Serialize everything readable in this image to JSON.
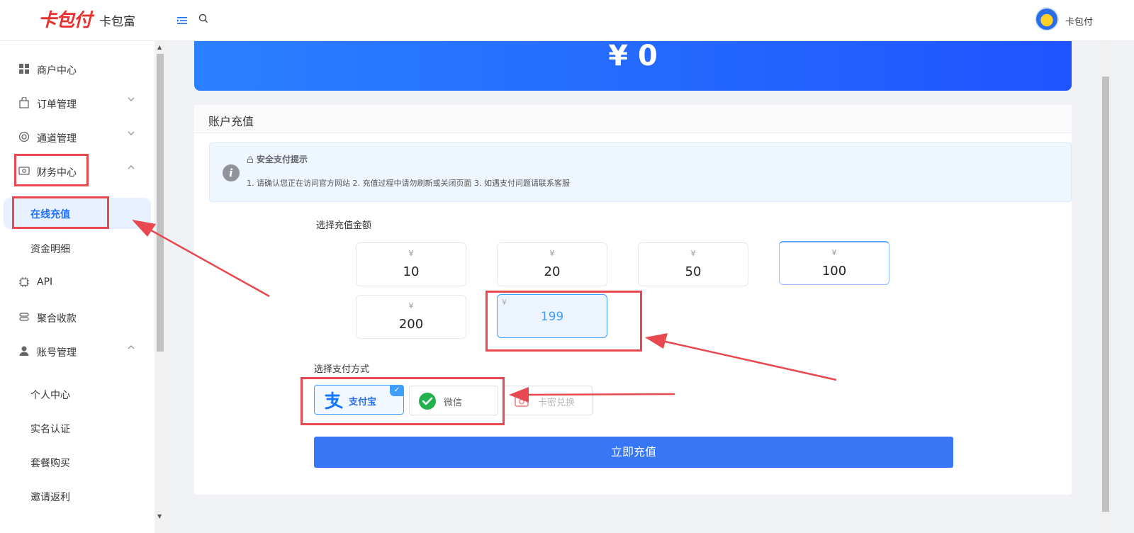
{
  "header": {
    "logo_text": "卡包付",
    "brand_name": "卡包富",
    "user_name": "卡包付",
    "menu_toggle_icon": "menu-fold-icon",
    "search_icon": "search-icon"
  },
  "sidebar": {
    "items": [
      {
        "label": "商户中心",
        "icon": "grid-icon"
      },
      {
        "label": "订单管理",
        "icon": "bag-icon"
      },
      {
        "label": "通道管理",
        "icon": "channel-icon"
      },
      {
        "label": "财务中心",
        "icon": "wallet-icon"
      },
      {
        "label": "API",
        "icon": "chip-icon"
      },
      {
        "label": "聚合收款",
        "icon": "aggregate-icon"
      },
      {
        "label": "账号管理",
        "icon": "user-icon"
      }
    ],
    "finance_sub": [
      {
        "label": "在线充值",
        "active": true
      },
      {
        "label": "资金明细"
      }
    ],
    "account_sub": [
      {
        "label": "个人中心"
      },
      {
        "label": "实名认证"
      },
      {
        "label": "套餐购买"
      },
      {
        "label": "邀请返利"
      }
    ]
  },
  "balance": {
    "display": "¥ 0"
  },
  "recharge": {
    "title": "账户充值",
    "notice_title": "安全支付提示",
    "notice_text": "1. 请确认您正在访问官方网站 2. 充值过程中请勿刷新或关闭页面 3. 如遇支付问题请联系客服",
    "amount_label": "选择充值金额",
    "currency": "¥",
    "amounts": [
      {
        "value": "10"
      },
      {
        "value": "20"
      },
      {
        "value": "50"
      },
      {
        "value": "100"
      },
      {
        "value": "200"
      },
      {
        "value": "199",
        "selected": true
      }
    ],
    "pay_label": "选择支付方式",
    "pay_methods": [
      {
        "label": "支付宝",
        "selected": true,
        "icon": "alipay-icon"
      },
      {
        "label": "微信",
        "icon": "wechat-icon"
      },
      {
        "label": "卡密兑换",
        "icon": "card-redeem-icon"
      }
    ],
    "submit_label": "立即充值"
  },
  "colors": {
    "accent": "#1e6fff",
    "banner_start": "#2b80ff",
    "banner_end": "#1e54ff",
    "annotation": "#e8484f",
    "submit": "#3777f5"
  }
}
